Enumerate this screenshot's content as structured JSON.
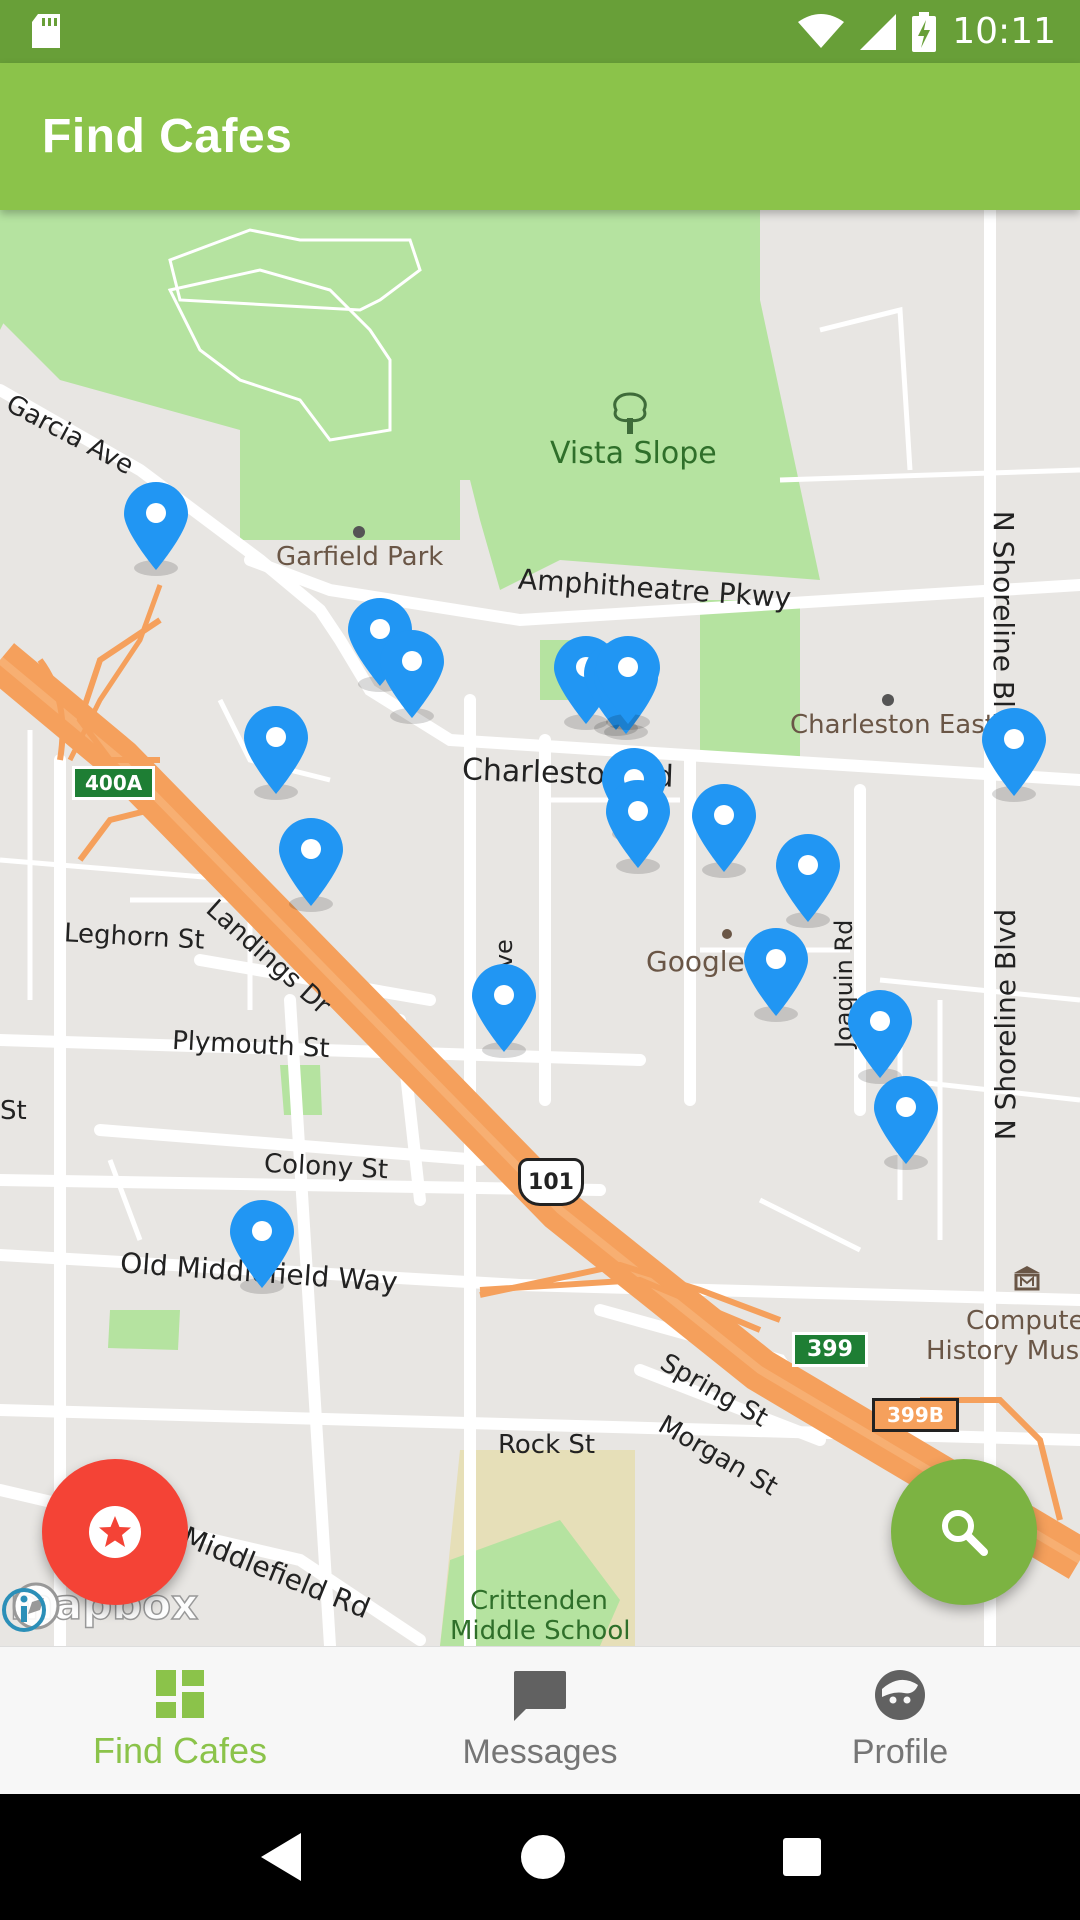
{
  "status_bar": {
    "time": "10:11",
    "icons": [
      "sd-card-icon",
      "wifi-icon",
      "cell-signal-icon",
      "battery-charging-icon"
    ]
  },
  "app_bar": {
    "title": "Find Cafes"
  },
  "map": {
    "labels": {
      "vista_slope": "Vista Slope",
      "garfield_park": "Garfield Park",
      "amphitheatre": "Amphitheatre Pkwy",
      "charleston_east": "Charleston East",
      "charleston_rd": "Charleston Rd",
      "garcia_ave": "Garcia Ave",
      "n_shoreline_top": "N Shoreline Blvd",
      "n_shoreline_bottom": "N Shoreline Blvd",
      "landings_dr": "Landings Dr",
      "leghorn_st": "Leghorn St",
      "plymouth_st": "Plymouth St",
      "colony_st": "Colony St",
      "old_middlefield": "Old Middlefield Way",
      "alta_ave": "Alta Ave",
      "joaquin_rd": "Joaquin Rd",
      "google": "Google",
      "spring_st": "Spring St",
      "morgan_st": "Morgan St",
      "rock_st": "Rock St",
      "crittenden_1": "Crittenden",
      "crittenden_2": "Middle School",
      "middlefield_rd": "Middlefield Rd",
      "computer_history_1": "Compute",
      "computer_history_2": "History Muse",
      "shield_400a": "400A",
      "shield_101": "101",
      "shield_399": "399",
      "shield_399b": "399B",
      "st_edge": "St"
    },
    "attribution": "mapbox",
    "marker_color": "#2196f3",
    "marker_count": 19
  },
  "fab": {
    "favorite_icon": "star-icon",
    "search_icon": "search-icon"
  },
  "bottom_nav": {
    "items": [
      {
        "label": "Find Cafes",
        "icon": "dashboard-icon",
        "active": true
      },
      {
        "label": "Messages",
        "icon": "message-icon",
        "active": false
      },
      {
        "label": "Profile",
        "icon": "face-icon",
        "active": false
      }
    ]
  },
  "colors": {
    "status_bar": "#689f38",
    "app_bar": "#8bc34a",
    "accent_red": "#f44336",
    "accent_green": "#7cb342"
  }
}
